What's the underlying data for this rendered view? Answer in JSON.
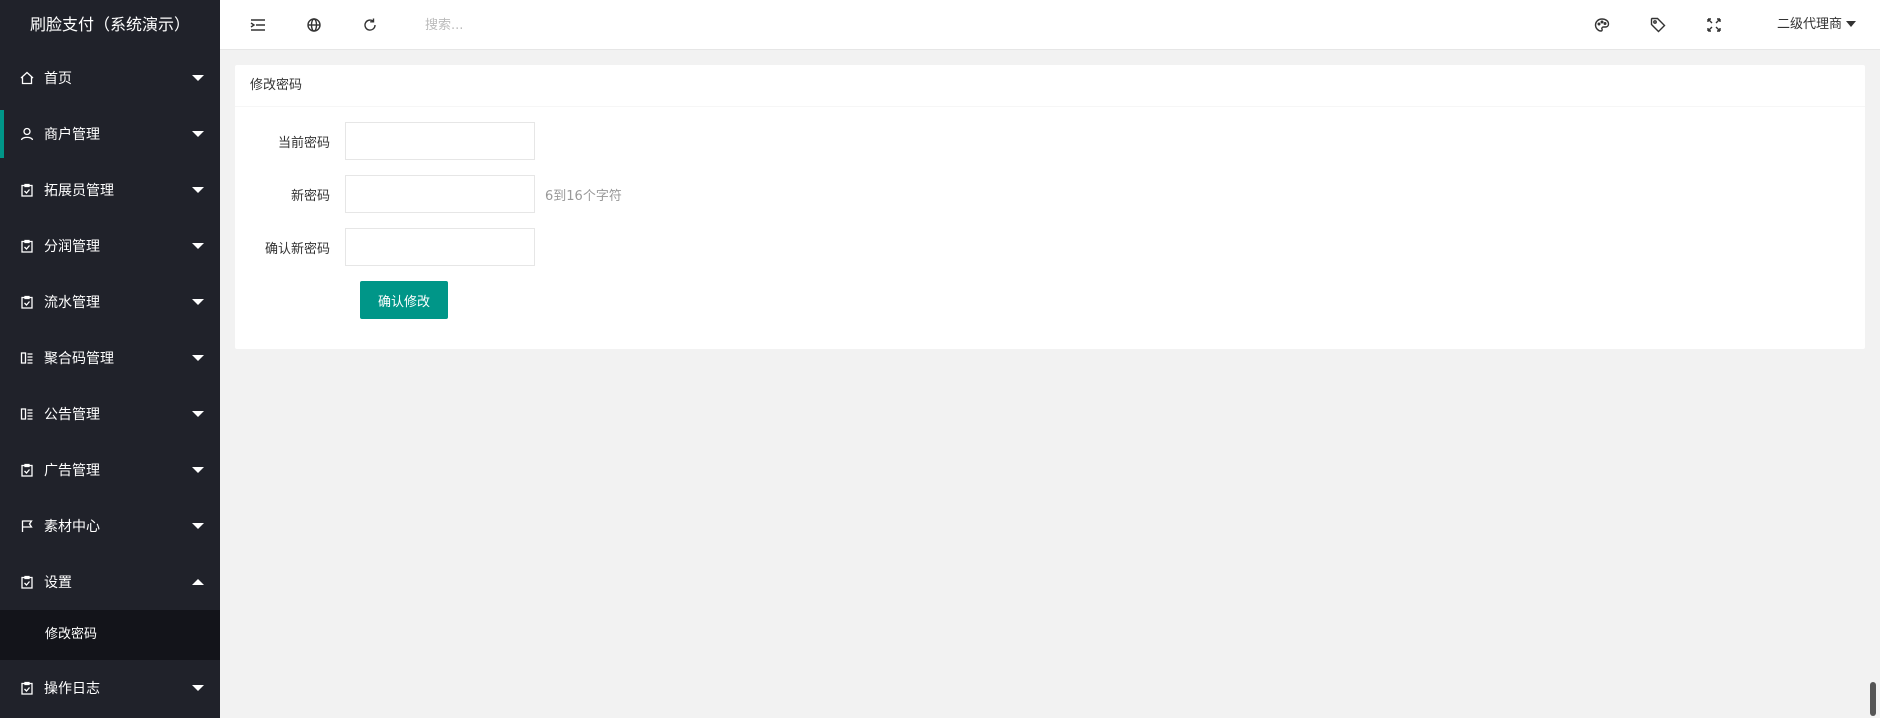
{
  "app": {
    "title": "刷脸支付（系统演示）"
  },
  "sidebar": {
    "items": [
      {
        "label": "首页",
        "icon": "home-icon"
      },
      {
        "label": "商户管理",
        "icon": "user-icon"
      },
      {
        "label": "拓展员管理",
        "icon": "clipboard-icon"
      },
      {
        "label": "分润管理",
        "icon": "clipboard-icon"
      },
      {
        "label": "流水管理",
        "icon": "clipboard-icon"
      },
      {
        "label": "聚合码管理",
        "icon": "list-icon"
      },
      {
        "label": "公告管理",
        "icon": "list-icon"
      },
      {
        "label": "广告管理",
        "icon": "clipboard-icon"
      },
      {
        "label": "素材中心",
        "icon": "flag-icon"
      },
      {
        "label": "设置",
        "icon": "clipboard-icon",
        "expanded": true
      },
      {
        "label": "操作日志",
        "icon": "clipboard-icon"
      }
    ],
    "submenu": {
      "label": "修改密码"
    }
  },
  "header": {
    "search_placeholder": "搜索...",
    "user_label": "二级代理商",
    "icons": [
      "menu-toggle-icon",
      "globe-icon",
      "refresh-icon",
      "palette-icon",
      "tag-icon",
      "fullscreen-icon"
    ]
  },
  "card": {
    "title": "修改密码",
    "fields": {
      "current_label": "当前密码",
      "new_label": "新密码",
      "new_tip": "6到16个字符",
      "confirm_label": "确认新密码"
    },
    "submit_label": "确认修改"
  },
  "colors": {
    "sidebar_bg": "#20222a",
    "submenu_bg": "#13141a",
    "accent": "#009688",
    "page_bg": "#f2f2f2"
  }
}
